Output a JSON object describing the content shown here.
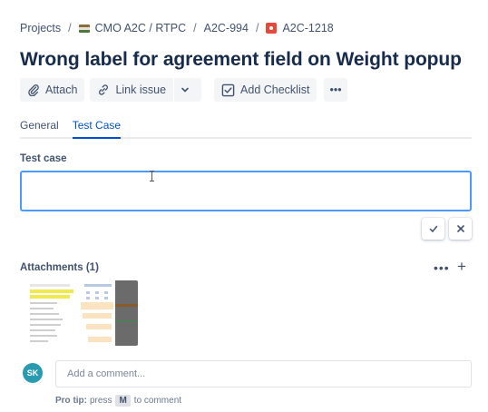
{
  "breadcrumb": {
    "projects": "Projects",
    "project": "CMO A2C / RTPC",
    "parent": "A2C-994",
    "issue": "A2C-1218",
    "separator": "/"
  },
  "issue": {
    "title": "Wrong label for agreement field on Weight popup"
  },
  "toolbar": {
    "attach_label": "Attach",
    "link_label": "Link issue",
    "checklist_label": "Add Checklist",
    "more_label": "•••"
  },
  "tabs": [
    {
      "label": "General",
      "active": false
    },
    {
      "label": "Test Case",
      "active": true
    }
  ],
  "test_case": {
    "label": "Test case",
    "value": ""
  },
  "attachments": {
    "title": "Attachments (1)",
    "more_label": "•••",
    "add_label": "+"
  },
  "comment": {
    "avatar_initials": "SK",
    "placeholder": "Add a comment...",
    "tip_prefix": "Pro tip:",
    "tip_press": "press",
    "tip_key": "M",
    "tip_suffix": "to comment"
  },
  "colors": {
    "accent": "#0052cc",
    "focus": "#4c9aff",
    "avatar": "#2a9ab0",
    "issue_type": "#e5493a"
  },
  "icons": [
    "paperclip-icon",
    "link-icon",
    "chevron-down-icon",
    "checklist-icon",
    "check-icon",
    "close-icon",
    "project-icon",
    "bug-icon"
  ]
}
